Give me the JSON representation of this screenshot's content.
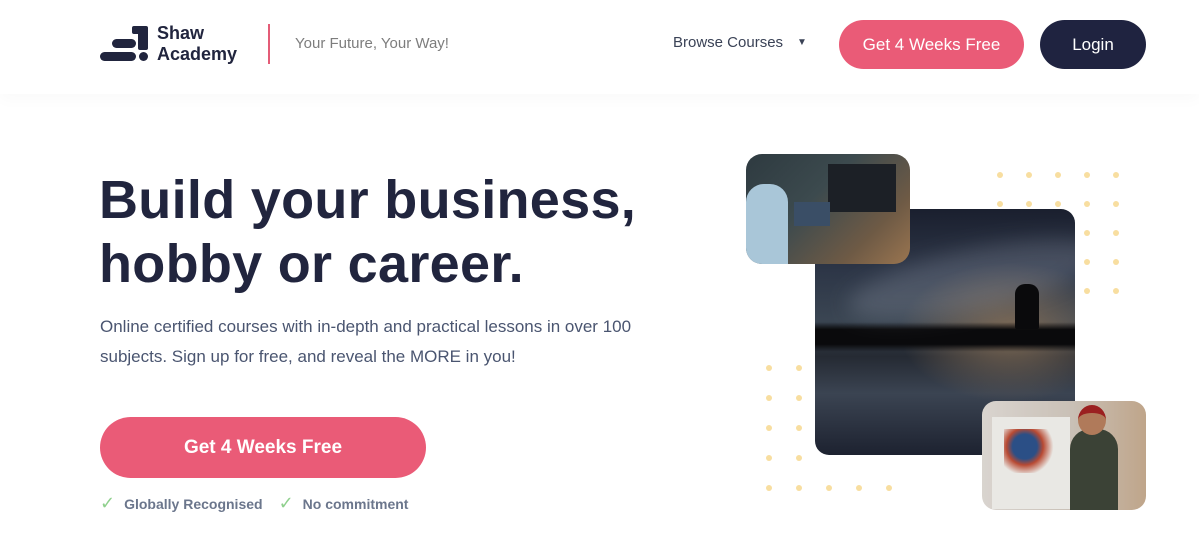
{
  "header": {
    "logo": {
      "line1": "Shaw",
      "line2": "Academy"
    },
    "tagline": "Your Future, Your Way!",
    "browse_label": "Browse Courses",
    "cta_label": "Get 4 Weeks Free",
    "login_label": "Login"
  },
  "hero": {
    "headline_line1": "Build your business,",
    "headline_line2": "hobby or career.",
    "subtext_line1": "Online certified courses with in-depth and practical lessons in over 100",
    "subtext_line2": "subjects. Sign up for free, and reveal the MORE in you!",
    "cta_label": "Get 4 Weeks Free",
    "features": [
      {
        "icon": "check-icon",
        "label": "Globally Recognised"
      },
      {
        "icon": "check-icon",
        "label": "No commitment"
      }
    ]
  },
  "images": [
    {
      "name": "coder-photo",
      "alt": "Person coding at desk with multiple screens"
    },
    {
      "name": "night-sky-photographer-photo",
      "alt": "Photographer silhouette under milky way"
    },
    {
      "name": "artist-photo",
      "alt": "Woman painting abstract canvas"
    }
  ],
  "colors": {
    "brand_pink": "#ea5b77",
    "brand_navy": "#1f2340",
    "dot_yellow": "#f8dea0",
    "check_green": "#8fd08d"
  }
}
